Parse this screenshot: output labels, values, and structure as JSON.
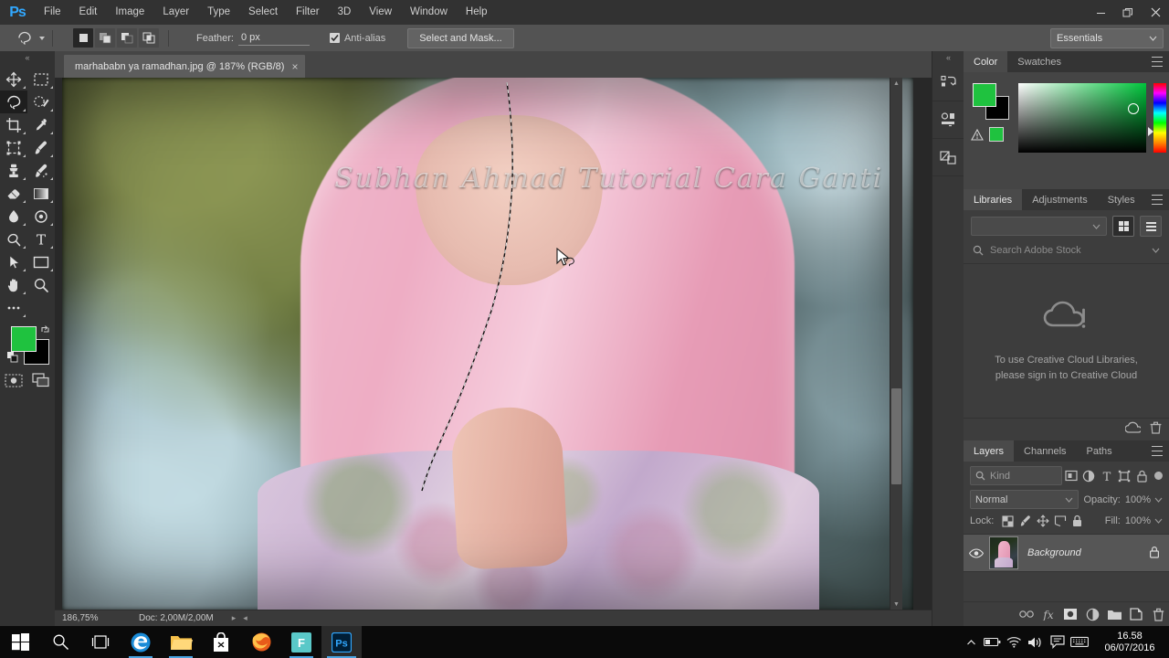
{
  "app": {
    "name": "Adobe Photoshop",
    "logo_text": "Ps",
    "accent": "#31a8ff"
  },
  "menubar": {
    "items": [
      "File",
      "Edit",
      "Image",
      "Layer",
      "Type",
      "Select",
      "Filter",
      "3D",
      "View",
      "Window",
      "Help"
    ]
  },
  "window_controls": {
    "minimize": "minimize-button",
    "restore": "restore-button",
    "close": "close-button"
  },
  "options_bar": {
    "tool": "lasso-tool",
    "selection_modes": [
      "new-selection",
      "add-to-selection",
      "subtract-from-selection",
      "intersect-with-selection"
    ],
    "active_selection_mode": 0,
    "feather_label": "Feather:",
    "feather_value": "0 px",
    "antialias_label": "Anti-alias",
    "antialias_checked": true,
    "select_and_mask_label": "Select and Mask...",
    "workspace_label": "Essentials"
  },
  "toolbar": {
    "tools_left": [
      "move-tool",
      "lasso-tool",
      "crop-tool",
      "frame-tool",
      "clone-stamp-tool",
      "eraser-tool",
      "blur-tool",
      "dodge-tool",
      "path-selection-tool",
      "hand-tool",
      "more-tools"
    ],
    "tools_right": [
      "marquee-tool",
      "quick-selection-tool",
      "eyedropper-tool",
      "brush-tool",
      "healing-brush-tool",
      "gradient-tool",
      "sponge-tool",
      "type-tool",
      "shape-tool",
      "zoom-tool"
    ],
    "active_tool": "lasso-tool",
    "foreground_color": "#1fc23f",
    "background_color": "#000000",
    "quick_mask": "edit-in-quick-mask-mode",
    "screen_mode": "change-screen-mode"
  },
  "document": {
    "tab_title": "marhababn ya ramadhan.jpg @ 187% (RGB/8)",
    "close_glyph": "×",
    "watermark_text": "Subhan Ahmad Tutorial Cara Ganti",
    "zoom_level": "186,75%",
    "doc_info": "Doc: 2,00M/2,00M"
  },
  "panel_rail": {
    "items": [
      "history-panel-icon",
      "properties-panel-icon",
      "clone-source-panel-icon"
    ]
  },
  "color_panel": {
    "tabs": [
      "Color",
      "Swatches"
    ],
    "active_tab": "Color",
    "foreground_color": "#1fc23f",
    "background_color": "#000000",
    "out_of_gamut_warning": "gamut-warning-icon"
  },
  "libraries_panel": {
    "tabs": [
      "Libraries",
      "Adjustments",
      "Styles"
    ],
    "active_tab": "Libraries",
    "library_select_value": "",
    "view_grid": "grid-view-button",
    "view_list": "list-view-button",
    "search_placeholder": "Search Adobe Stock",
    "empty_line1": "To use Creative Cloud Libraries,",
    "empty_line2": "please sign in to Creative Cloud",
    "footer_icons": [
      "sync-cloud-icon",
      "delete-icon"
    ]
  },
  "layers_panel": {
    "tabs": [
      "Layers",
      "Channels",
      "Paths"
    ],
    "active_tab": "Layers",
    "filter_label": "Kind",
    "filter_icons": [
      "filter-pixel-icon",
      "filter-adjustment-icon",
      "filter-type-icon",
      "filter-shape-icon",
      "filter-smartobject-icon"
    ],
    "blend_mode": "Normal",
    "opacity_label": "Opacity:",
    "opacity_value": "100%",
    "lock_label": "Lock:",
    "lock_icons": [
      "lock-transparent-pixels-icon",
      "lock-image-pixels-icon",
      "lock-position-icon",
      "lock-artboard-icon",
      "lock-all-icon"
    ],
    "fill_label": "Fill:",
    "fill_value": "100%",
    "layers": [
      {
        "name": "Background",
        "visible": true,
        "locked": true
      }
    ],
    "bottom_buttons": [
      "link-layers-icon",
      "layer-style-fx-icon",
      "add-layer-mask-icon",
      "new-adjustment-layer-icon",
      "new-group-icon",
      "new-layer-icon",
      "delete-layer-icon"
    ]
  },
  "taskbar": {
    "items": [
      "start-button",
      "search-icon",
      "task-view-icon",
      "edge-icon",
      "file-explorer-icon",
      "store-icon",
      "firefox-icon",
      "foxit-icon",
      "photoshop-icon"
    ],
    "active_item": "photoshop-icon",
    "tray_icons": [
      "battery-icon",
      "wifi-icon",
      "volume-icon",
      "action-center-icon",
      "keyboard-icon"
    ],
    "tray_expand": "show-hidden-icons-chevron",
    "time": "16.58",
    "date": "06/07/2016"
  }
}
